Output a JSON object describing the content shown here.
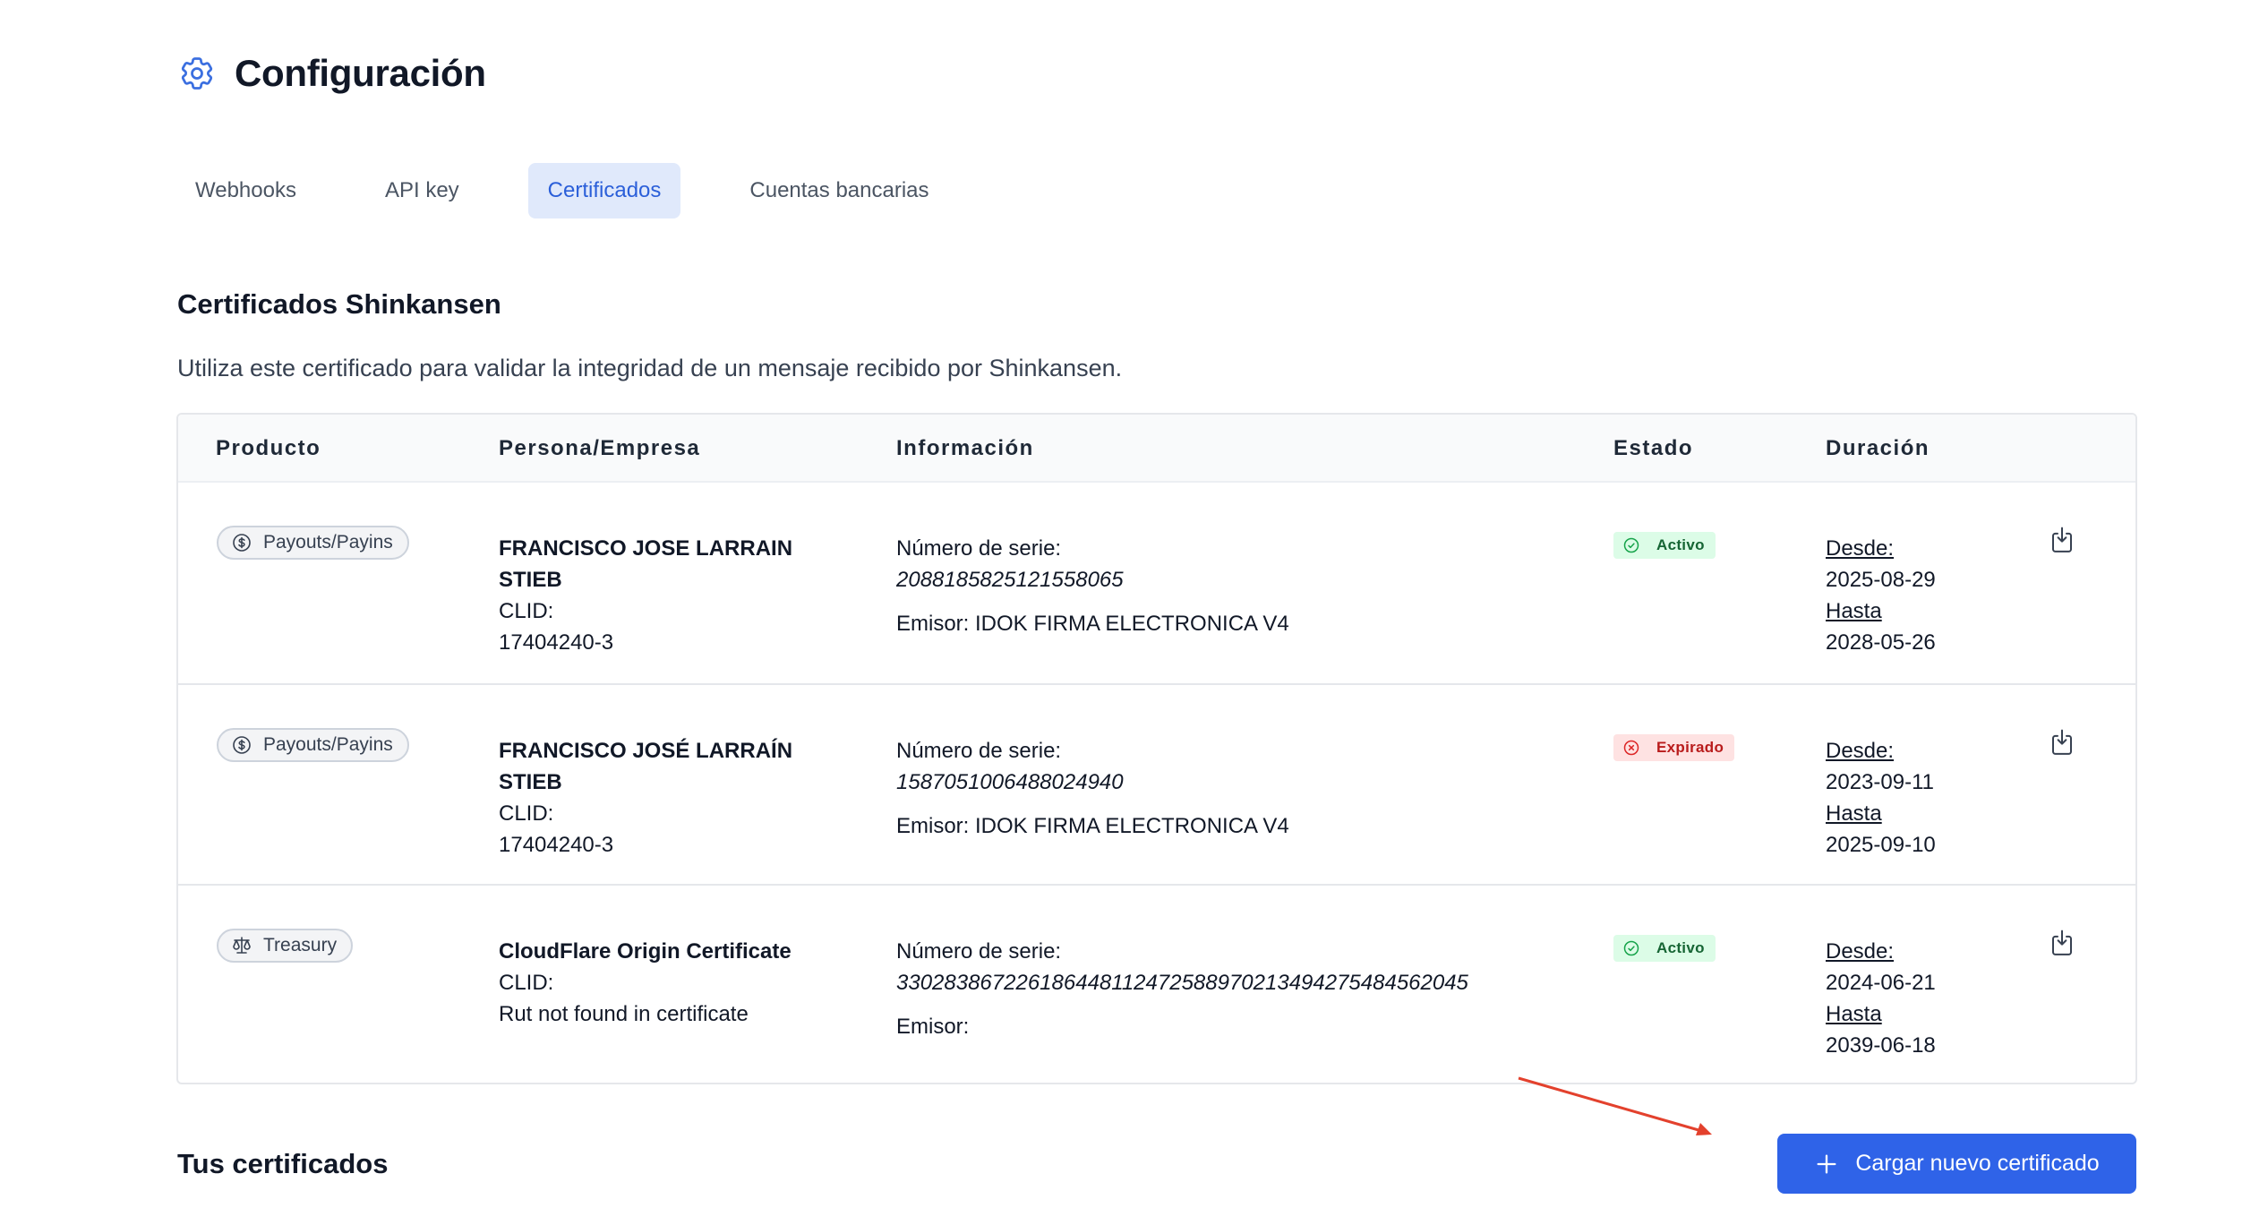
{
  "page": {
    "title": "Configuración"
  },
  "tabs": [
    {
      "label": "Webhooks",
      "active": false
    },
    {
      "label": "API key",
      "active": false
    },
    {
      "label": "Certificados",
      "active": true
    },
    {
      "label": "Cuentas bancarias",
      "active": false
    }
  ],
  "shinkansen": {
    "title": "Certificados Shinkansen",
    "description": "Utiliza este certificado para validar la integridad de un mensaje recibido por Shinkansen."
  },
  "table": {
    "headers": {
      "producto": "Producto",
      "persona": "Persona/Empresa",
      "informacion": "Información",
      "estado": "Estado",
      "duracion": "Duración"
    },
    "rows": [
      {
        "product": "Payouts/Payins",
        "product_icon": "dollar-circle-icon",
        "name": "FRANCISCO JOSE LARRAIN STIEB",
        "clid_label": "CLID:",
        "clid": "17404240-3",
        "serial_label": "Número de serie:",
        "serial": "2088185825121558065",
        "issuer": "Emisor: IDOK FIRMA ELECTRONICA V4",
        "status": "Activo",
        "status_icon": "check-circle-icon",
        "from_label": "Desde:",
        "from": "2025-08-29",
        "to_label": "Hasta",
        "to": "2028-05-26"
      },
      {
        "product": "Payouts/Payins",
        "product_icon": "dollar-circle-icon",
        "name": "FRANCISCO JOSÉ LARRAÍN STIEB",
        "clid_label": "CLID:",
        "clid": "17404240-3",
        "serial_label": "Número de serie:",
        "serial": "1587051006488024940",
        "issuer": "Emisor: IDOK FIRMA ELECTRONICA V4",
        "status": "Expirado",
        "status_icon": "x-circle-icon",
        "from_label": "Desde:",
        "from": "2023-09-11",
        "to_label": "Hasta",
        "to": "2025-09-10"
      },
      {
        "product": "Treasury",
        "product_icon": "scale-icon",
        "name": "CloudFlare Origin Certificate",
        "clid_label": "CLID:",
        "clid": "Rut not found in certificate",
        "serial_label": "Número de serie:",
        "serial": "330283867226186448112472588970213494275484562045",
        "issuer": "Emisor:",
        "status": "Activo",
        "status_icon": "check-circle-icon",
        "from_label": "Desde:",
        "from": "2024-06-21",
        "to_label": "Hasta",
        "to": "2039-06-18"
      }
    ]
  },
  "own": {
    "title": "Tus certificados",
    "upload_button": "Cargar nuevo certificado"
  },
  "colors": {
    "primary": "#2f63e8",
    "active_tab_bg": "#e0e9fb",
    "status_ok_bg": "#dcfce7",
    "status_bad_bg": "#fee2e2",
    "annotation_arrow": "#e3412d"
  }
}
